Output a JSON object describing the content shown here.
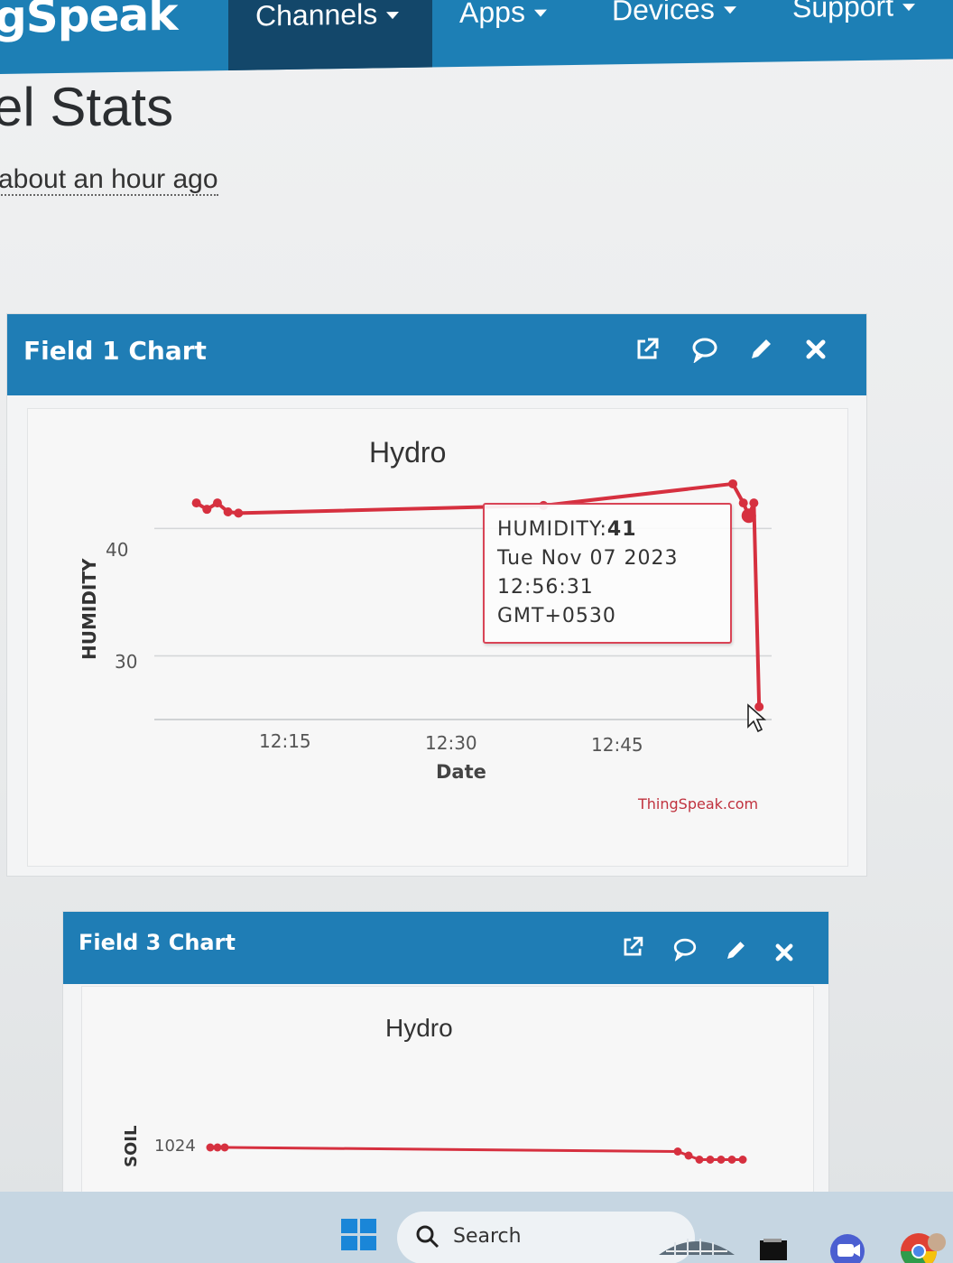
{
  "nav": {
    "logo": "gSpeak",
    "items": [
      {
        "label": "Channels",
        "active": true
      },
      {
        "label": "Apps",
        "active": false
      },
      {
        "label": "Devices",
        "active": false
      },
      {
        "label": "Support",
        "active": false
      }
    ]
  },
  "page": {
    "heading": "el Stats",
    "updated": "about an hour ago"
  },
  "panels": [
    {
      "title": "Field 1 Chart",
      "icons": [
        "external-link-icon",
        "comment-icon",
        "pencil-icon",
        "close-icon"
      ]
    },
    {
      "title": "Field 3 Chart",
      "icons": [
        "external-link-icon",
        "comment-icon",
        "pencil-icon",
        "close-icon"
      ]
    }
  ],
  "chart_data": [
    {
      "type": "line",
      "title": "Hydro",
      "xlabel": "Date",
      "ylabel": "HUMIDITY",
      "y_ticks": [
        "40",
        "30"
      ],
      "x_ticks": [
        "12:15",
        "12:30",
        "12:45"
      ],
      "ylim": [
        25,
        43
      ],
      "color": "#d6303f",
      "series": [
        {
          "x": [
            "12:04",
            "12:05",
            "12:06",
            "12:07",
            "12:08",
            "12:37",
            "12:55",
            "12:56",
            "12:56:31",
            "12:57",
            "12:57:30"
          ],
          "values": [
            42,
            41.5,
            42,
            41.3,
            41.2,
            41.8,
            43.5,
            42,
            41,
            42,
            26
          ]
        }
      ],
      "tooltip": {
        "label": "HUMIDITY:",
        "value": "41",
        "date": "Tue Nov 07 2023",
        "time": "12:56:31 GMT+0530"
      },
      "credit": "ThingSpeak.com"
    },
    {
      "type": "line",
      "title": "Hydro",
      "ylabel": "SOIL",
      "y_ticks": [
        "1024"
      ],
      "color": "#d6303f",
      "series": [
        {
          "values": [
            1024,
            1024,
            1024,
            1023,
            1022,
            1021,
            1021,
            1021,
            1021,
            1021
          ]
        }
      ]
    }
  ],
  "taskbar": {
    "search_label": "Search"
  }
}
